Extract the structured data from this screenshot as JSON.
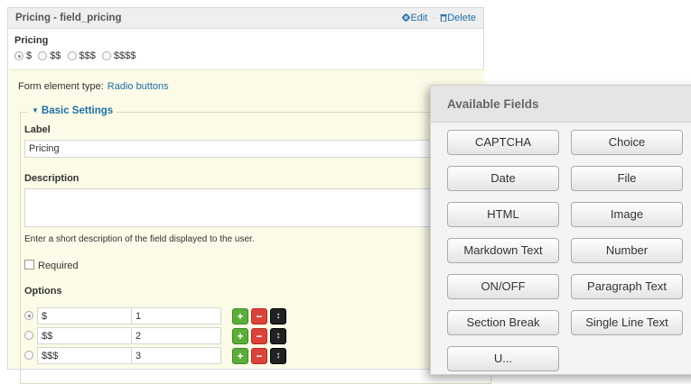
{
  "field": {
    "title": "Pricing - field_pricing",
    "edit_label": "Edit",
    "sep": "·",
    "delete_label": "Delete"
  },
  "preview": {
    "label": "Pricing",
    "options": [
      "$",
      "$$",
      "$$$",
      "$$$$"
    ],
    "selected_index": 0
  },
  "form_element": {
    "label": "Form element type:",
    "value": "Radio buttons"
  },
  "basic_settings": {
    "legend": "Basic Settings",
    "label_field_label": "Label",
    "label_value": "Pricing",
    "description_label": "Description",
    "description_value": "",
    "description_help": "Enter a short description of the field displayed to the user.",
    "required_label": "Required",
    "required_checked": false,
    "options_label": "Options",
    "options": [
      {
        "label": "$",
        "value": "1",
        "selected": true
      },
      {
        "label": "$$",
        "value": "2",
        "selected": false
      },
      {
        "label": "$$$",
        "value": "3",
        "selected": false
      }
    ],
    "add_symbol": "+",
    "remove_symbol": "−",
    "drag_symbol": "↕"
  },
  "available_fields": {
    "title": "Available Fields",
    "buttons": [
      "CAPTCHA",
      "Choice",
      "Date",
      "File",
      "HTML",
      "Image",
      "Markdown Text",
      "Number",
      "ON/OFF",
      "Paragraph Text",
      "Section Break",
      "Single Line Text",
      "U..."
    ]
  },
  "icons": {
    "edit": "gear-icon",
    "delete": "trash-icon",
    "legend_toggle": "triangle-down-icon"
  },
  "colors": {
    "link": "#1f6fa8",
    "settings_bg": "#fbfbe7",
    "add_button": "#5cae3b",
    "remove_button": "#d9433b",
    "drag_button": "#222222"
  }
}
